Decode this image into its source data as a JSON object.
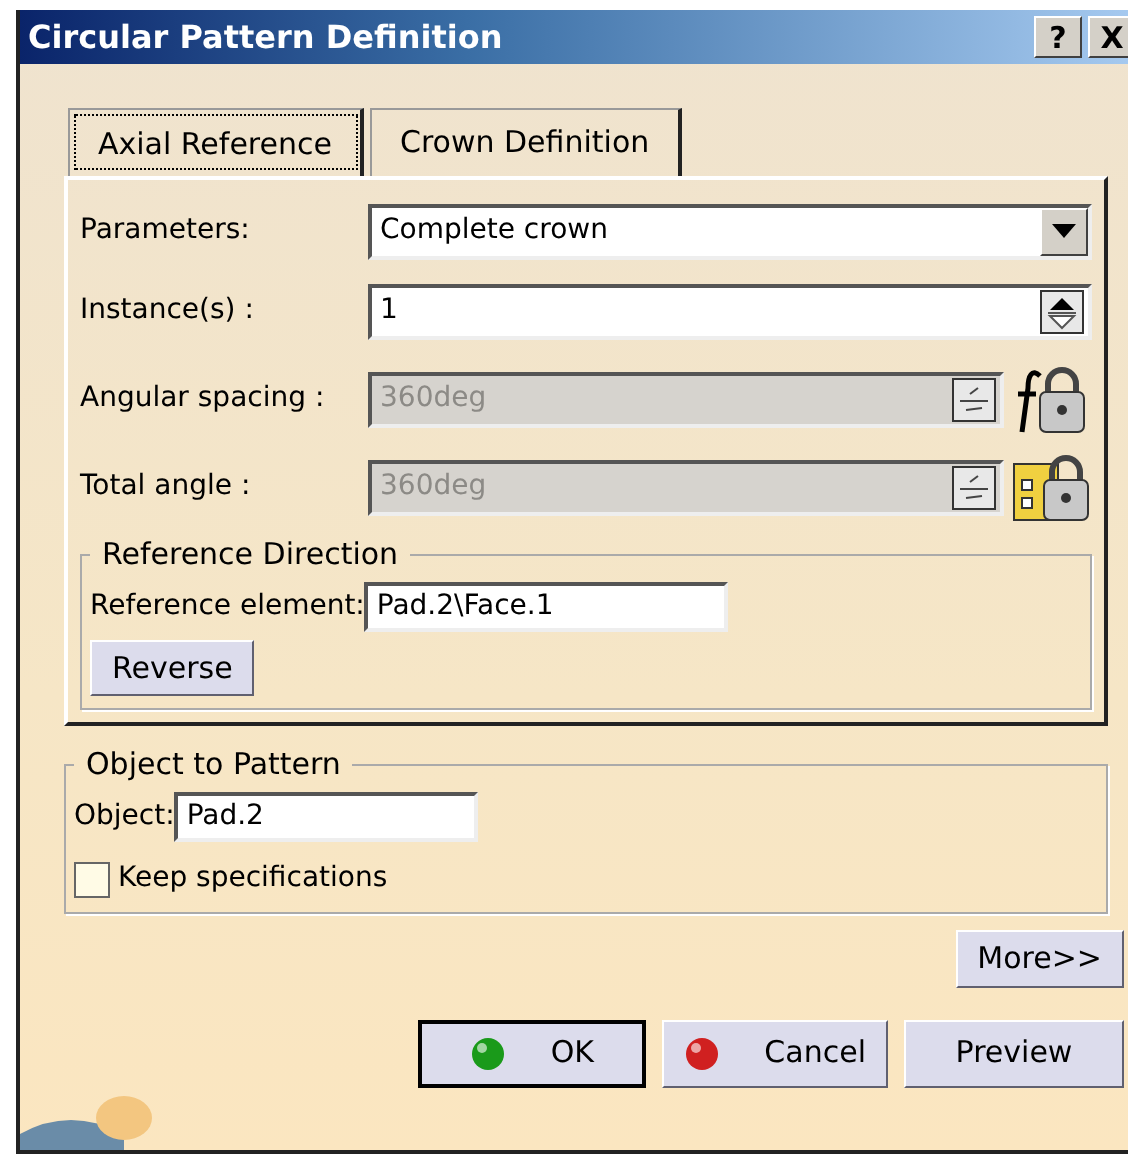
{
  "window": {
    "title": "Circular Pattern Definition",
    "title_buttons": [
      "?",
      "X"
    ]
  },
  "tabs": [
    {
      "label": "Axial Reference",
      "selected": true
    },
    {
      "label": "Crown Definition",
      "selected": false
    }
  ],
  "parameters": [
    {
      "kind": "dropdown",
      "label": "Parameters:",
      "value": "Complete crown",
      "disabled": false
    },
    {
      "kind": "spinner",
      "label": "Instance(s) :",
      "value": "1",
      "disabled": false
    },
    {
      "kind": "spinner",
      "label": "Angular spacing :",
      "value": "360deg",
      "disabled": true
    },
    {
      "kind": "spinner",
      "label": "Total angle :",
      "value": "360deg",
      "disabled": true
    }
  ],
  "reference_direction": {
    "title": "Reference Direction",
    "element_label": "Reference element:",
    "element_value": "Pad.2\\Face.1",
    "reverse_button": "Reverse"
  },
  "object_to_pattern": {
    "title": "Object to Pattern",
    "object_label": "Object:",
    "object_value": "Pad.2",
    "keep_specifications": {
      "label": "Keep specifications",
      "checked": false
    }
  },
  "more_button": "More>>",
  "buttons": [
    {
      "kind": "ok",
      "label": "OK",
      "default": true
    },
    {
      "kind": "cancel",
      "label": "Cancel",
      "default": false
    },
    {
      "kind": "plain",
      "label": "Preview",
      "default": false
    }
  ]
}
